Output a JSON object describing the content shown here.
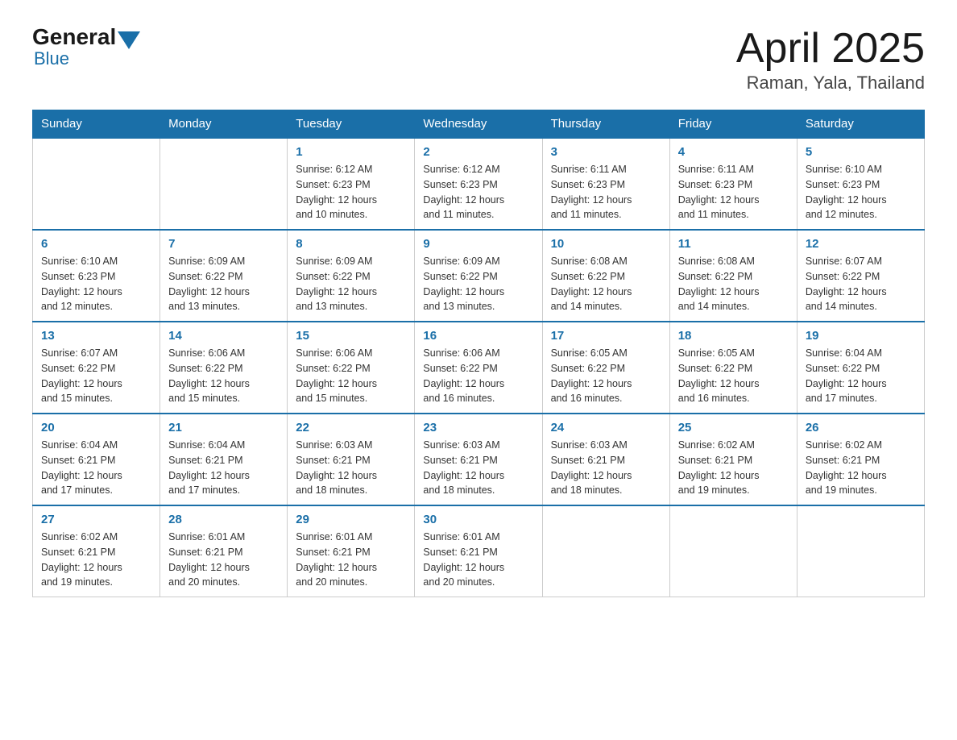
{
  "header": {
    "logo_general": "General",
    "logo_blue": "Blue",
    "title": "April 2025",
    "subtitle": "Raman, Yala, Thailand"
  },
  "days_of_week": [
    "Sunday",
    "Monday",
    "Tuesday",
    "Wednesday",
    "Thursday",
    "Friday",
    "Saturday"
  ],
  "weeks": [
    [
      {
        "day": "",
        "info": ""
      },
      {
        "day": "",
        "info": ""
      },
      {
        "day": "1",
        "info": "Sunrise: 6:12 AM\nSunset: 6:23 PM\nDaylight: 12 hours\nand 10 minutes."
      },
      {
        "day": "2",
        "info": "Sunrise: 6:12 AM\nSunset: 6:23 PM\nDaylight: 12 hours\nand 11 minutes."
      },
      {
        "day": "3",
        "info": "Sunrise: 6:11 AM\nSunset: 6:23 PM\nDaylight: 12 hours\nand 11 minutes."
      },
      {
        "day": "4",
        "info": "Sunrise: 6:11 AM\nSunset: 6:23 PM\nDaylight: 12 hours\nand 11 minutes."
      },
      {
        "day": "5",
        "info": "Sunrise: 6:10 AM\nSunset: 6:23 PM\nDaylight: 12 hours\nand 12 minutes."
      }
    ],
    [
      {
        "day": "6",
        "info": "Sunrise: 6:10 AM\nSunset: 6:23 PM\nDaylight: 12 hours\nand 12 minutes."
      },
      {
        "day": "7",
        "info": "Sunrise: 6:09 AM\nSunset: 6:22 PM\nDaylight: 12 hours\nand 13 minutes."
      },
      {
        "day": "8",
        "info": "Sunrise: 6:09 AM\nSunset: 6:22 PM\nDaylight: 12 hours\nand 13 minutes."
      },
      {
        "day": "9",
        "info": "Sunrise: 6:09 AM\nSunset: 6:22 PM\nDaylight: 12 hours\nand 13 minutes."
      },
      {
        "day": "10",
        "info": "Sunrise: 6:08 AM\nSunset: 6:22 PM\nDaylight: 12 hours\nand 14 minutes."
      },
      {
        "day": "11",
        "info": "Sunrise: 6:08 AM\nSunset: 6:22 PM\nDaylight: 12 hours\nand 14 minutes."
      },
      {
        "day": "12",
        "info": "Sunrise: 6:07 AM\nSunset: 6:22 PM\nDaylight: 12 hours\nand 14 minutes."
      }
    ],
    [
      {
        "day": "13",
        "info": "Sunrise: 6:07 AM\nSunset: 6:22 PM\nDaylight: 12 hours\nand 15 minutes."
      },
      {
        "day": "14",
        "info": "Sunrise: 6:06 AM\nSunset: 6:22 PM\nDaylight: 12 hours\nand 15 minutes."
      },
      {
        "day": "15",
        "info": "Sunrise: 6:06 AM\nSunset: 6:22 PM\nDaylight: 12 hours\nand 15 minutes."
      },
      {
        "day": "16",
        "info": "Sunrise: 6:06 AM\nSunset: 6:22 PM\nDaylight: 12 hours\nand 16 minutes."
      },
      {
        "day": "17",
        "info": "Sunrise: 6:05 AM\nSunset: 6:22 PM\nDaylight: 12 hours\nand 16 minutes."
      },
      {
        "day": "18",
        "info": "Sunrise: 6:05 AM\nSunset: 6:22 PM\nDaylight: 12 hours\nand 16 minutes."
      },
      {
        "day": "19",
        "info": "Sunrise: 6:04 AM\nSunset: 6:22 PM\nDaylight: 12 hours\nand 17 minutes."
      }
    ],
    [
      {
        "day": "20",
        "info": "Sunrise: 6:04 AM\nSunset: 6:21 PM\nDaylight: 12 hours\nand 17 minutes."
      },
      {
        "day": "21",
        "info": "Sunrise: 6:04 AM\nSunset: 6:21 PM\nDaylight: 12 hours\nand 17 minutes."
      },
      {
        "day": "22",
        "info": "Sunrise: 6:03 AM\nSunset: 6:21 PM\nDaylight: 12 hours\nand 18 minutes."
      },
      {
        "day": "23",
        "info": "Sunrise: 6:03 AM\nSunset: 6:21 PM\nDaylight: 12 hours\nand 18 minutes."
      },
      {
        "day": "24",
        "info": "Sunrise: 6:03 AM\nSunset: 6:21 PM\nDaylight: 12 hours\nand 18 minutes."
      },
      {
        "day": "25",
        "info": "Sunrise: 6:02 AM\nSunset: 6:21 PM\nDaylight: 12 hours\nand 19 minutes."
      },
      {
        "day": "26",
        "info": "Sunrise: 6:02 AM\nSunset: 6:21 PM\nDaylight: 12 hours\nand 19 minutes."
      }
    ],
    [
      {
        "day": "27",
        "info": "Sunrise: 6:02 AM\nSunset: 6:21 PM\nDaylight: 12 hours\nand 19 minutes."
      },
      {
        "day": "28",
        "info": "Sunrise: 6:01 AM\nSunset: 6:21 PM\nDaylight: 12 hours\nand 20 minutes."
      },
      {
        "day": "29",
        "info": "Sunrise: 6:01 AM\nSunset: 6:21 PM\nDaylight: 12 hours\nand 20 minutes."
      },
      {
        "day": "30",
        "info": "Sunrise: 6:01 AM\nSunset: 6:21 PM\nDaylight: 12 hours\nand 20 minutes."
      },
      {
        "day": "",
        "info": ""
      },
      {
        "day": "",
        "info": ""
      },
      {
        "day": "",
        "info": ""
      }
    ]
  ]
}
